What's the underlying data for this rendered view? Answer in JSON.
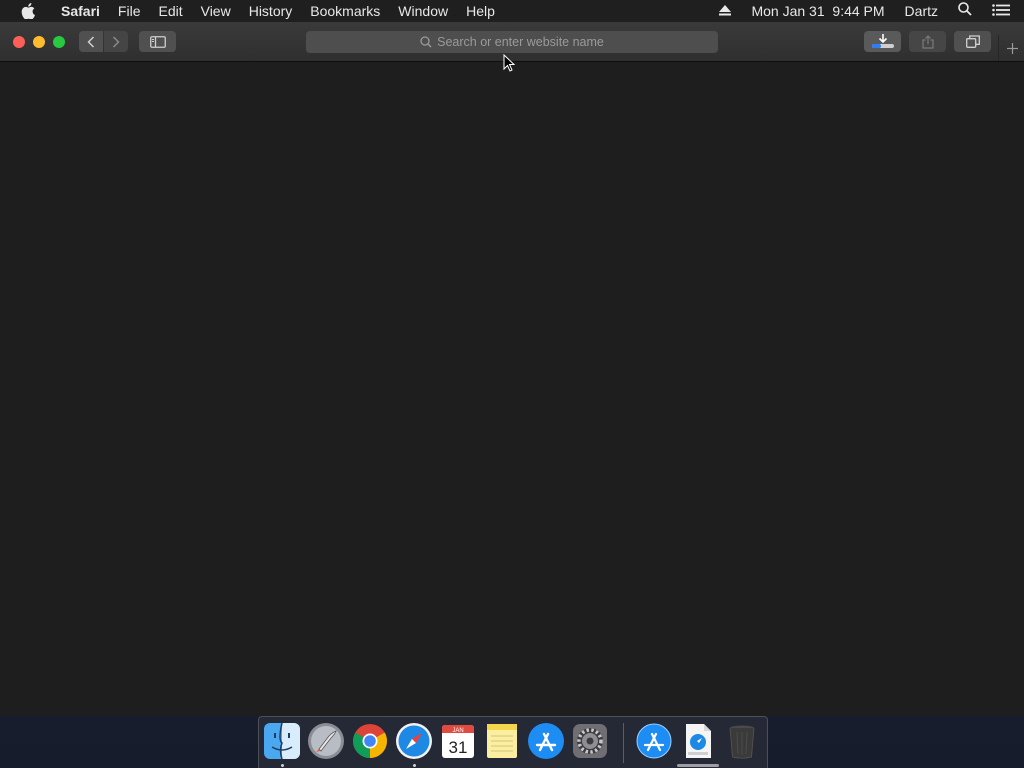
{
  "menubar": {
    "app_name": "Safari",
    "items": [
      "File",
      "Edit",
      "View",
      "History",
      "Bookmarks",
      "Window",
      "Help"
    ],
    "clock": "Mon Jan 31  9:44 PM",
    "user": "Dartz",
    "icons": [
      "apple-logo",
      "eject-icon",
      "spotlight-search-icon",
      "notification-center-icon"
    ]
  },
  "toolbar": {
    "address_placeholder": "Search or enter website name",
    "icons": [
      "back-chevron",
      "forward-chevron",
      "sidebar-icon",
      "download-icon",
      "share-icon",
      "tabs-overview-icon",
      "plus-icon"
    ]
  },
  "calendar": {
    "month": "JAN",
    "day": "31"
  },
  "dock": {
    "apps": [
      "Finder",
      "Launchpad",
      "Google Chrome",
      "Safari",
      "Calendar",
      "Notes",
      "App Store",
      "System Preferences",
      "Applications",
      "Downloads",
      "Trash"
    ],
    "running": [
      "Finder",
      "Safari"
    ]
  },
  "colors": {
    "close": "#ff5f57",
    "minimize": "#febc2e",
    "maximize": "#28c840",
    "content_bg": "#1e1e1e"
  }
}
